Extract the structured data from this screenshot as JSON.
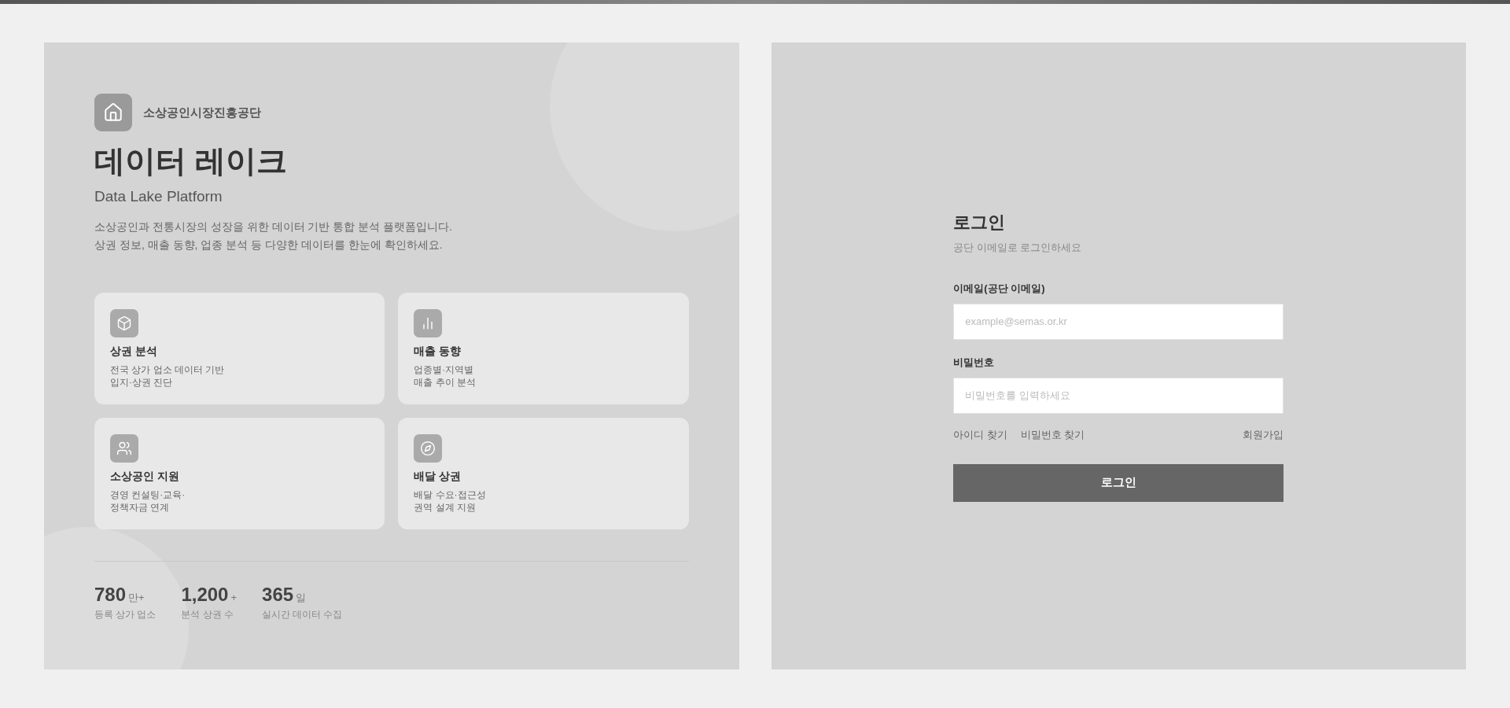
{
  "intro": {
    "organization": "소상공인시장진흥공단",
    "title": "데이터 레이크",
    "subtitle": "Data Lake Platform",
    "description": "소상공인과 전통시장의 성장을 위한 데이터 기반 통합 분석 플랫폼입니다.\n상권 정보, 매출 동향, 업종 분석 등 다양한 데이터를 한눈에 확인하세요."
  },
  "features": [
    {
      "title": "상권 분석",
      "description": "전국 상가 업소 데이터 기반\n입지·상권 진단"
    },
    {
      "title": "매출 동향",
      "description": "업종별·지역별\n매출 추이 분석"
    },
    {
      "title": "소상공인 지원",
      "description": "경영 컨설팅·교육·\n정책자금 연계"
    },
    {
      "title": "배달 상권",
      "description": "배달 수요·접근성\n권역 설계 지원"
    }
  ],
  "stats": [
    {
      "value": "780",
      "unit": "만+",
      "label": "등록 상가 업소"
    },
    {
      "value": "1,200",
      "unit": "+",
      "label": "분석 상권 수"
    },
    {
      "value": "365",
      "unit": "일",
      "label": "실시간 데이터 수집"
    }
  ],
  "login": {
    "title": "로그인",
    "subtitle": "공단 이메일로 로그인하세요",
    "fields": [
      {
        "label": "이메일(공단 이메일)",
        "placeholder": "example@semas.or.kr"
      },
      {
        "label": "비밀번호",
        "placeholder": "비밀번호를 입력하세요"
      }
    ],
    "links": [
      {
        "label": "아이디 찾기"
      },
      {
        "label": "비밀번호 찾기"
      }
    ],
    "signup": "회원가입",
    "button": "로그인"
  }
}
